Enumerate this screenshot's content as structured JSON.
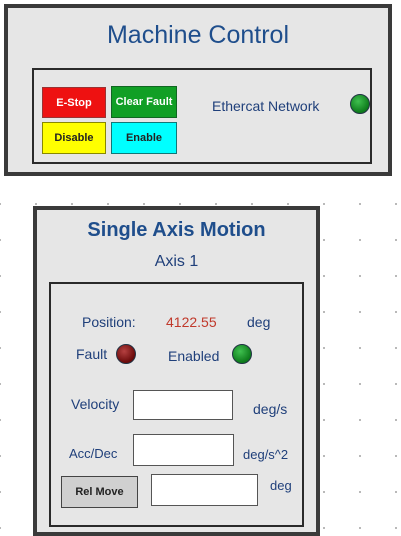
{
  "machine_control": {
    "title": "Machine Control",
    "buttons": {
      "estop": "E-Stop",
      "clear_fault": "Clear Fault",
      "disable": "Disable",
      "enable": "Enable"
    },
    "network_label": "Ethercat Network",
    "network_status_color": "#119f25"
  },
  "single_axis": {
    "title": "Single Axis Motion",
    "axis_label": "Axis 1",
    "position_label": "Position:",
    "position_value": "4122.55",
    "position_unit": "deg",
    "fault_label": "Fault",
    "fault_color": "#8b0000",
    "enabled_label": "Enabled",
    "enabled_color": "#119f25",
    "velocity_label": "Velocity",
    "velocity_value": "",
    "velocity_unit": "deg/s",
    "accdec_label": "Acc/Dec",
    "accdec_value": "",
    "accdec_unit": "deg/s^2",
    "relmove_label": "Rel Move",
    "relmove_value": "",
    "relmove_unit": "deg"
  }
}
